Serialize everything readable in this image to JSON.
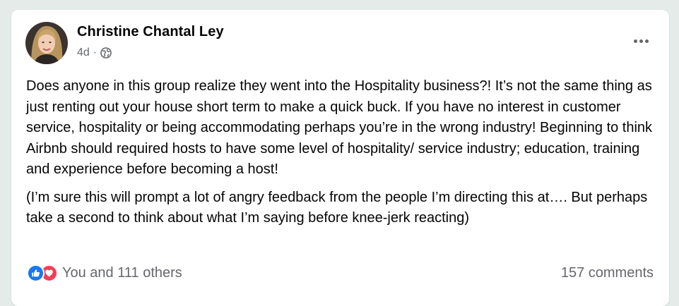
{
  "post": {
    "author": "Christine Chantal Ley",
    "time": "4d",
    "separator": "·",
    "audience_icon": "globe-icon",
    "paragraphs": [
      "Does anyone in this group realize they went into the Hospitality business?!  It’s not the same thing as just renting out your house short term to make a quick buck.  If you have no interest in customer service, hospitality or being accommodating perhaps you’re in the wrong industry!  Beginning to think Airbnb should required hosts to have some level of hospitality/ service industry; education, training and experience before becoming a host!",
      "(I’m sure this will prompt a lot of angry feedback from the people I’m directing this at…. But perhaps take a second to think about what I’m saying before knee-jerk reacting)"
    ],
    "reactions_text": "You and 111 others",
    "comments_text": "157 comments",
    "reaction_icons": [
      "like-icon",
      "love-icon"
    ]
  },
  "colors": {
    "like": "#1877f2",
    "love": "#f33e58",
    "muted_text": "#65676b",
    "page_background": "#e4ebe8"
  }
}
